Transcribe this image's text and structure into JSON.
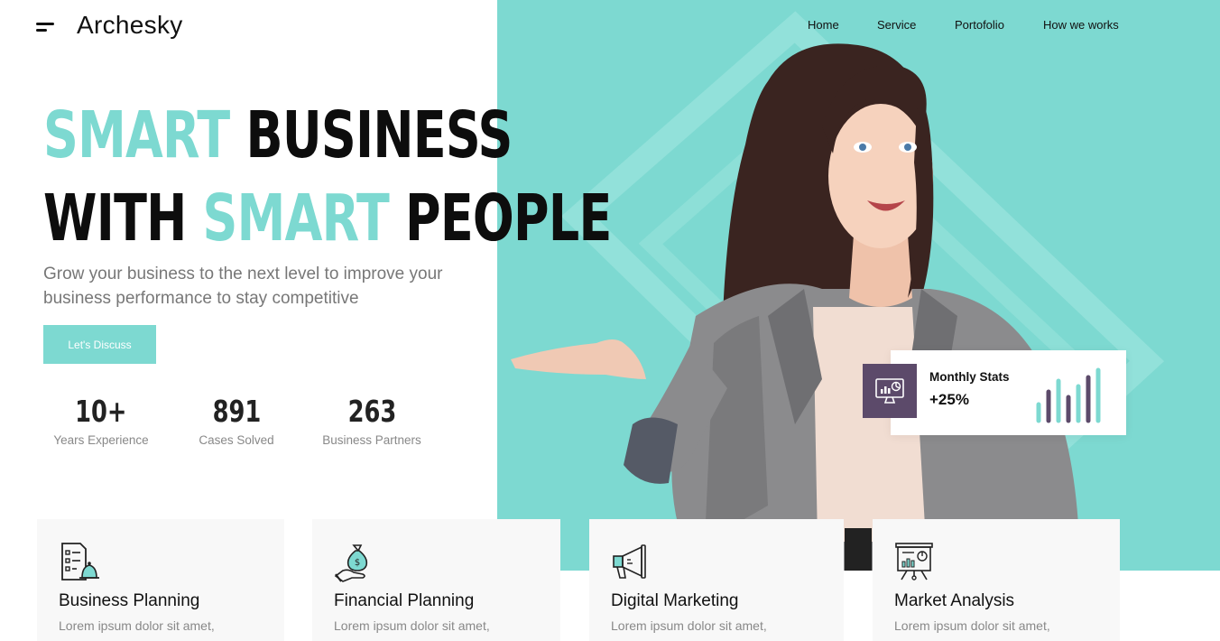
{
  "brand": {
    "name": "Archesky"
  },
  "nav": {
    "items": [
      {
        "label": "Home"
      },
      {
        "label": "Service"
      },
      {
        "label": "Portofolio"
      },
      {
        "label": "How we works"
      }
    ]
  },
  "hero": {
    "headline_line1_accent": "SMART",
    "headline_line1_rest": "BUSINESS",
    "headline_line2_start": "WITH",
    "headline_line2_accent": "SMART",
    "headline_line2_end": "PEOPLE",
    "subtitle": "Grow your business to the next level to improve your business performance to stay competitive",
    "cta_label": "Let's Discuss"
  },
  "stats": [
    {
      "value": "10+",
      "label": "Years Experience"
    },
    {
      "value": "891",
      "label": "Cases Solved"
    },
    {
      "value": "263",
      "label": "Business Partners"
    }
  ],
  "monthly_stats": {
    "title": "Monthly Stats",
    "value": "+25%",
    "icon": "monitor-chart-icon"
  },
  "services": [
    {
      "title": "Business Planning",
      "text": "Lorem ipsum dolor sit amet,",
      "icon": "checklist-bell-icon"
    },
    {
      "title": "Financial Planning",
      "text": "Lorem ipsum dolor sit amet,",
      "icon": "money-bag-hand-icon"
    },
    {
      "title": "Digital Marketing",
      "text": "Lorem ipsum dolor sit amet,",
      "icon": "megaphone-icon"
    },
    {
      "title": "Market Analysis",
      "text": "Lorem ipsum dolor sit amet,",
      "icon": "presentation-board-icon"
    }
  ],
  "colors": {
    "accent": "#7dd9d1",
    "purple": "#5c4a6a",
    "text_dark": "#0d0d0d",
    "text_muted": "#777777"
  }
}
